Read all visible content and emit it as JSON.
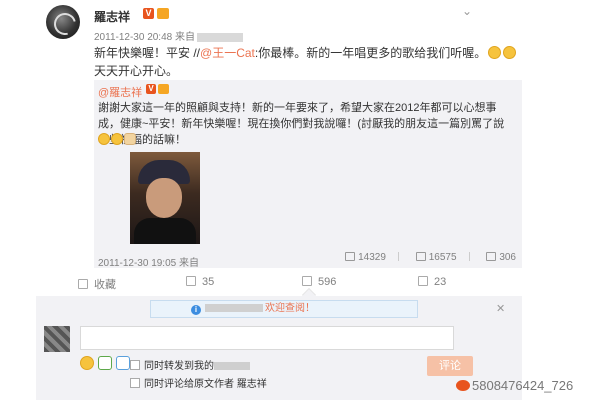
{
  "post": {
    "author": "羅志祥",
    "verified_label": "V",
    "timestamp": "2011-12-30 20:48",
    "source_prefix": "来自",
    "text_line1_before": "新年快樂喔！平安 //",
    "mention": "@王一Cat",
    "text_line1_after": ":你最棒。新的一年唱更多的歌给我们听喔。",
    "text_line2": "天天开心开心。"
  },
  "repost": {
    "author": "@羅志祥",
    "text": "謝謝大家這一年的照顧與支持！新的一年要來了，希望大家在2012年都可以心想事成，健康~平安！新年快樂喔！現在換你們對我說囉！(討厭我的朋友這一篇別罵了說一些祝福的話嘛！",
    "timestamp": "2011-12-30 19:05",
    "source_prefix": "来自",
    "reposts": "14329",
    "comments": "16575",
    "likes": "306"
  },
  "actions": {
    "favorite": "收藏",
    "repost": "35",
    "comment": "596",
    "like": "23"
  },
  "comment_box": {
    "welcome": "欢迎查阅！",
    "close": "✕",
    "option_repost": "同时转发到我的",
    "option_comment_prefix": "同时评论给原文作者",
    "option_comment_author": "羅志祥",
    "submit": "评论"
  },
  "watermark": "5808476424_726",
  "colors": {
    "accent": "#eb7350",
    "verified": "#e8541e",
    "panel": "#f2f2f5"
  }
}
